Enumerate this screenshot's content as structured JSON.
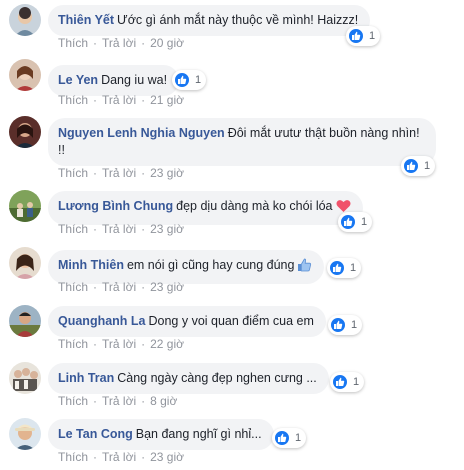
{
  "colors": {
    "author": "#385898",
    "bubble": "#f2f3f5",
    "action": "#90949c",
    "like": "#1877f2",
    "heart": "#f0526a"
  },
  "comments": [
    {
      "author": "Thiên Yết",
      "text": "Ước gì ánh mắt này thuộc về mình! Haizzz!",
      "reactions": "1",
      "like_label": "Thích",
      "reply_label": "Trả lời",
      "time": "20 giờ"
    },
    {
      "author": "Le Yen",
      "text": "Dang iu wa!",
      "reactions": "1",
      "like_label": "Thích",
      "reply_label": "Trả lời",
      "time": "21 giờ"
    },
    {
      "author": "Nguyen Lenh Nghia Nguyen",
      "text": "Đôi mắt ưutư thật buồn nàng nhìn! !!",
      "reactions": "1",
      "like_label": "Thích",
      "reply_label": "Trả lời",
      "time": "23 giờ"
    },
    {
      "author": "Lương Bình Chung",
      "text": "đẹp dịu dàng mà ko chói lóa",
      "emoji": "heart-icon",
      "reactions": "1",
      "like_label": "Thích",
      "reply_label": "Trả lời",
      "time": "23 giờ"
    },
    {
      "author": "Minh Thiên",
      "text": "em nói gì cũng hay cung đúng",
      "emoji": "thumbs-up-icon",
      "reactions": "1",
      "like_label": "Thích",
      "reply_label": "Trả lời",
      "time": "23 giờ"
    },
    {
      "author": "Quanghanh La",
      "text": "Dong y voi quan điểm cua em",
      "reactions": "1",
      "like_label": "Thích",
      "reply_label": "Trả lời",
      "time": "22 giờ"
    },
    {
      "author": "Linh Tran",
      "text": "Càng ngày càng đẹp nghen cưng ...",
      "reactions": "1",
      "like_label": "Thích",
      "reply_label": "Trả lời",
      "time": "8 giờ"
    },
    {
      "author": "Le Tan Cong",
      "text": "Bạn đang nghĩ gì nhỉ...",
      "reactions": "1",
      "like_label": "Thích",
      "reply_label": "Trả lời",
      "time": "23 giờ"
    }
  ]
}
